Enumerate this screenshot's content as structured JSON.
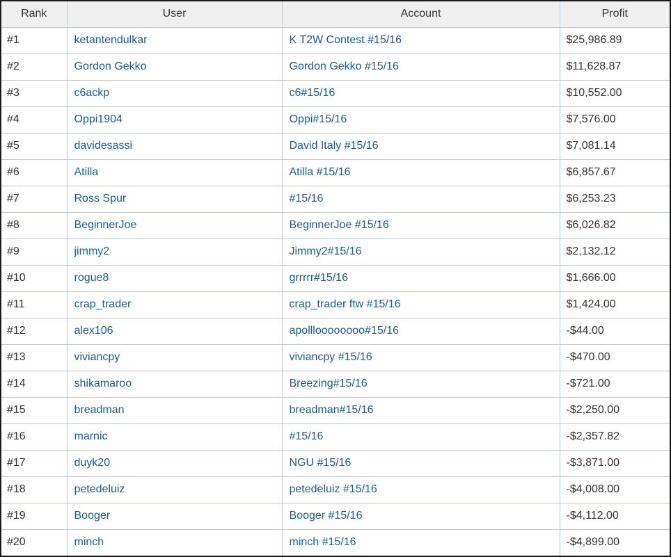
{
  "table": {
    "headers": [
      "Rank",
      "User",
      "Account",
      "Profit"
    ],
    "rows": [
      {
        "rank": "#1",
        "user": "ketantendulkar",
        "account": "K T2W Contest #15/16",
        "profit": "$25,986.89"
      },
      {
        "rank": "#2",
        "user": "Gordon Gekko",
        "account": "Gordon Gekko #15/16",
        "profit": "$11,628.87"
      },
      {
        "rank": "#3",
        "user": "c6ackp",
        "account": "c6#15/16",
        "profit": "$10,552.00"
      },
      {
        "rank": "#4",
        "user": "Oppi1904",
        "account": "Oppi#15/16",
        "profit": "$7,576.00"
      },
      {
        "rank": "#5",
        "user": "davidesassi",
        "account": "David Italy #15/16",
        "profit": "$7,081.14"
      },
      {
        "rank": "#6",
        "user": "Atilla",
        "account": "Atilla #15/16",
        "profit": "$6,857.67"
      },
      {
        "rank": "#7",
        "user": "Ross Spur",
        "account": "#15/16",
        "profit": "$6,253.23"
      },
      {
        "rank": "#8",
        "user": "BeginnerJoe",
        "account": "BeginnerJoe #15/16",
        "profit": "$6,026.82"
      },
      {
        "rank": "#9",
        "user": "jimmy2",
        "account": "Jimmy2#15/16",
        "profit": "$2,132.12"
      },
      {
        "rank": "#10",
        "user": "rogue8",
        "account": "grrrrr#15/16",
        "profit": "$1,666.00"
      },
      {
        "rank": "#11",
        "user": "crap_trader",
        "account": "crap_trader ftw #15/16",
        "profit": "$1,424.00"
      },
      {
        "rank": "#12",
        "user": "alex106",
        "account": "apollloooooooo#15/16",
        "profit": "-$44.00"
      },
      {
        "rank": "#13",
        "user": "viviancpy",
        "account": "viviancpy #15/16",
        "profit": "-$470.00"
      },
      {
        "rank": "#14",
        "user": "shikamaroo",
        "account": "Breezing#15/16",
        "profit": "-$721.00"
      },
      {
        "rank": "#15",
        "user": "breadman",
        "account": "breadman#15/16",
        "profit": "-$2,250.00"
      },
      {
        "rank": "#16",
        "user": "marnic",
        "account": "#15/16",
        "profit": "-$2,357.82"
      },
      {
        "rank": "#17",
        "user": "duyk20",
        "account": "NGU #15/16",
        "profit": "-$3,871.00"
      },
      {
        "rank": "#18",
        "user": "petedeluiz",
        "account": "petedeluiz #15/16",
        "profit": "-$4,008.00"
      },
      {
        "rank": "#19",
        "user": "Booger",
        "account": "Booger #15/16",
        "profit": "-$4,112.00"
      },
      {
        "rank": "#20",
        "user": "minch",
        "account": "minch #15/16",
        "profit": "-$4,899.00"
      }
    ]
  },
  "colors": {
    "link": "#1d5b8c",
    "text": "#333333",
    "header_bg": "#efefef",
    "border": "#b9cdd8",
    "frame": "#1a1a1a"
  }
}
